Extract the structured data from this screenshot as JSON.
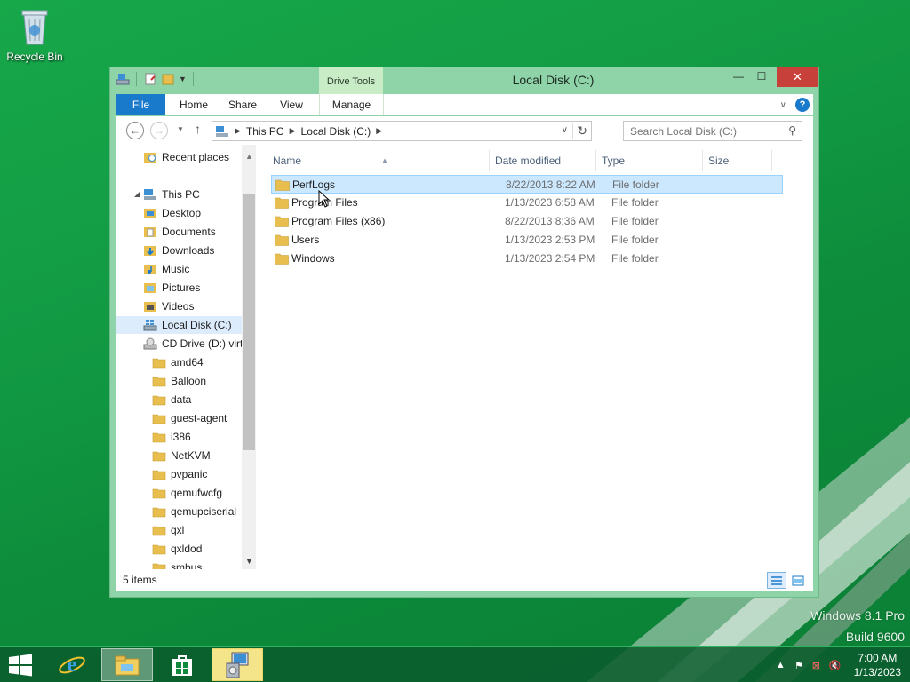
{
  "desktop": {
    "recycle_bin_label": "Recycle Bin",
    "watermark_line1": "Windows 8.1 Pro",
    "watermark_line2": "Build 9600"
  },
  "window": {
    "title": "Local Disk (C:)",
    "context_tab": "Drive Tools",
    "ribbon_tabs": [
      "File",
      "Home",
      "Share",
      "View",
      "Manage"
    ],
    "minimize_glyph": "—",
    "maximize_glyph": "☐",
    "close_glyph": "✕",
    "help_glyph": "?"
  },
  "address": {
    "segments": [
      "This PC",
      "Local Disk (C:)"
    ],
    "search_placeholder": "Search Local Disk (C:)"
  },
  "nav_pane": {
    "recent": "Recent places",
    "this_pc": "This PC",
    "pc_items": [
      "Desktop",
      "Documents",
      "Downloads",
      "Music",
      "Pictures",
      "Videos"
    ],
    "local_disk": "Local Disk (C:)",
    "cd_drive": "CD Drive (D:) virt",
    "cd_items": [
      "amd64",
      "Balloon",
      "data",
      "guest-agent",
      "i386",
      "NetKVM",
      "pvpanic",
      "qemufwcfg",
      "qemupciserial",
      "qxl",
      "qxldod",
      "smbus"
    ]
  },
  "file_list": {
    "columns": [
      "Name",
      "Date modified",
      "Type",
      "Size"
    ],
    "rows": [
      {
        "name": "PerfLogs",
        "date": "8/22/2013 8:22 AM",
        "type": "File folder"
      },
      {
        "name": "Program Files",
        "date": "1/13/2023 6:58 AM",
        "type": "File folder"
      },
      {
        "name": "Program Files (x86)",
        "date": "8/22/2013 8:36 AM",
        "type": "File folder"
      },
      {
        "name": "Users",
        "date": "1/13/2023 2:53 PM",
        "type": "File folder"
      },
      {
        "name": "Windows",
        "date": "1/13/2023 2:54 PM",
        "type": "File folder"
      }
    ]
  },
  "status": {
    "item_count": "5 items"
  },
  "taskbar": {
    "time": "7:00 AM",
    "date": "1/13/2023"
  },
  "colors": {
    "accent": "#1979ca",
    "titlebar": "#8fd3a8",
    "close": "#c7413a",
    "folder": "#e8bf4f"
  }
}
